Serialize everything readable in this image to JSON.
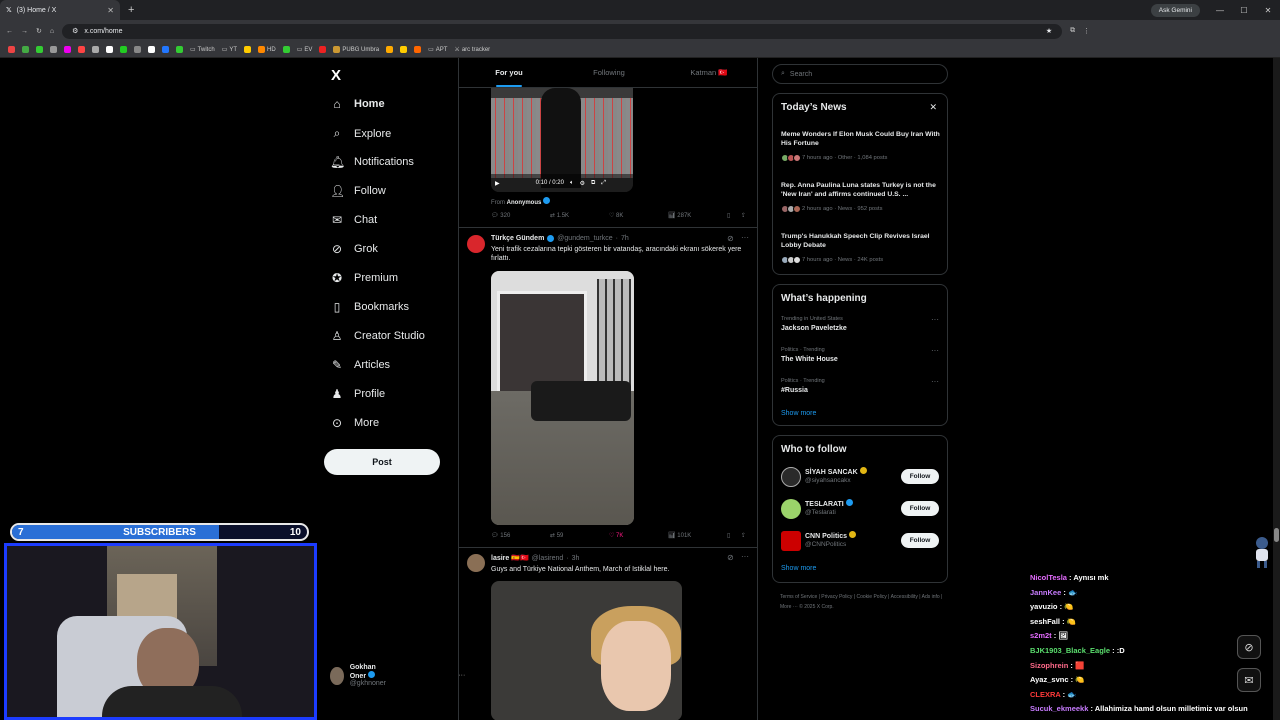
{
  "browser": {
    "tab_title": "(3) Home / X",
    "url": "x.com/home",
    "ask_gemini": "Ask Gemini",
    "bookmarks": [
      {
        "label": "Twitch"
      },
      {
        "label": "YT"
      },
      {
        "label": "HD"
      },
      {
        "label": "EV"
      },
      {
        "label": "PUBG Umbra"
      },
      {
        "label": "APT"
      },
      {
        "label": "arc tracker"
      }
    ]
  },
  "nav": {
    "logo": "X",
    "items": [
      {
        "label": "Home",
        "icon": "home-icon"
      },
      {
        "label": "Explore",
        "icon": "search-icon"
      },
      {
        "label": "Notifications",
        "icon": "bell-icon"
      },
      {
        "label": "Follow",
        "icon": "person-add-icon"
      },
      {
        "label": "Chat",
        "icon": "mail-icon"
      },
      {
        "label": "Grok",
        "icon": "grok-icon"
      },
      {
        "label": "Premium",
        "icon": "premium-icon"
      },
      {
        "label": "Bookmarks",
        "icon": "bookmark-icon"
      },
      {
        "label": "Creator Studio",
        "icon": "creator-icon"
      },
      {
        "label": "Articles",
        "icon": "articles-icon"
      },
      {
        "label": "Profile",
        "icon": "profile-icon"
      },
      {
        "label": "More",
        "icon": "more-icon"
      }
    ],
    "post_label": "Post",
    "account": {
      "name": "Gokhan Oner",
      "handle": "@gkhnoner"
    }
  },
  "feed": {
    "tabs": [
      "For you",
      "Following",
      "Katman 🇹🇷"
    ],
    "video_time": "0:10 / 0:20",
    "from_label": "From",
    "from_name": "Anonymous",
    "post1_actions": {
      "replies": "320",
      "reposts": "1.5K",
      "likes": "8K",
      "views": "287K"
    },
    "post2": {
      "name": "Türkçe Gündem",
      "handle": "@gundem_turkce",
      "time": "7h",
      "text": "Yeni trafik cezalarına tepki gösteren bir vatandaş, aracındaki ekranı sökerek yere fırlattı.",
      "actions": {
        "replies": "156",
        "reposts": "59",
        "likes": "7K",
        "views": "101K"
      }
    },
    "post3": {
      "name": "lasire 🇪🇸🇹🇷",
      "handle": "@lasirend",
      "time": "3h",
      "text": "Guys and Türkiye National Anthem, March of Istiklal here."
    }
  },
  "sidebar": {
    "search_placeholder": "Search",
    "news_title": "Today’s News",
    "news": [
      {
        "headline": "Meme Wonders If Elon Musk Could Buy Iran With His Fortune",
        "meta": "7 hours ago · Other · 1,084 posts"
      },
      {
        "headline": "Rep. Anna Paulina Luna states Turkey is not the 'New Iran' and affirms continued U.S. ...",
        "meta": "2 hours ago · News · 952 posts"
      },
      {
        "headline": "Trump's Hanukkah Speech Clip Revives Israel Lobby Debate",
        "meta": "7 hours ago · News · 24K posts"
      }
    ],
    "happening_title": "What’s happening",
    "trends": [
      {
        "category": "Trending in United States",
        "name": "Jackson Paveletzke"
      },
      {
        "category": "Politics · Trending",
        "name": "The White House"
      },
      {
        "category": "Politics · Trending",
        "name": "#Russia"
      }
    ],
    "show_more": "Show more",
    "who_title": "Who to follow",
    "follow_suggestions": [
      {
        "name": "SİYAH SANCAK",
        "handle": "@siyahsancakx",
        "color": "#2a2a2a"
      },
      {
        "name": "TESLARATI",
        "handle": "@Teslarati",
        "color": "#9bd36a"
      },
      {
        "name": "CNN Politics",
        "handle": "@CNNPolitics",
        "color": "#cc0000"
      }
    ],
    "follow_label": "Follow",
    "footer": "Terms of Service | Privacy Policy | Cookie Policy | Accessibility | Ads info | More ··· © 2025 X Corp."
  },
  "stream": {
    "subs_left": "7",
    "subs_label": "SUBSCRIBERS",
    "subs_right": "10",
    "subs_progress": 0.7,
    "chat": [
      {
        "user": "NicolTesla",
        "msg": "Aynısı mk",
        "color": "#e56cff"
      },
      {
        "user": "JannKee",
        "msg": "🐟",
        "color": "#c87cff"
      },
      {
        "user": "yavuzio",
        "msg": "🍋",
        "color": "#ffffff"
      },
      {
        "user": "seshFall",
        "msg": "🍋",
        "color": "#ffffff"
      },
      {
        "user": "s2m2t",
        "msg": "🖼",
        "color": "#e56cff"
      },
      {
        "user": "BJK1903_Black_Eagle",
        "msg": ":D",
        "color": "#5bdf6e"
      },
      {
        "user": "Sizophrein",
        "msg": "🟥",
        "color": "#ff6a8a"
      },
      {
        "user": "Ayaz_svnc",
        "msg": "🍋",
        "color": "#ffffff"
      },
      {
        "user": "CLEXRA",
        "msg": "🐟",
        "color": "#ff3a3a"
      },
      {
        "user": "Sucuk_ekmeekk",
        "msg": "Allahimiza hamd olsun milletimiz var olsun",
        "color": "#c87cff"
      }
    ]
  }
}
